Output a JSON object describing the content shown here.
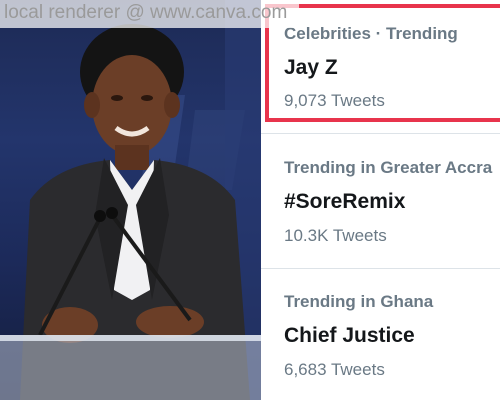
{
  "watermark": {
    "text": "local renderer @ www.canva.com"
  },
  "photo": {
    "alt_subject": "man-in-suit-at-podium-icon"
  },
  "trends": [
    {
      "meta": "Celebrities · Trending",
      "title": "Jay Z",
      "count": "9,073 Tweets",
      "highlighted": true
    },
    {
      "meta": "Trending in Greater Accra",
      "title": "#SoreRemix",
      "count": "10.3K Tweets",
      "highlighted": false
    },
    {
      "meta": "Trending in Ghana",
      "title": "Chief Justice",
      "count": "6,683 Tweets",
      "highlighted": false
    }
  ],
  "colors": {
    "highlight": "#e8344c",
    "meta_text": "#6a7985",
    "title_text": "#14171a"
  }
}
